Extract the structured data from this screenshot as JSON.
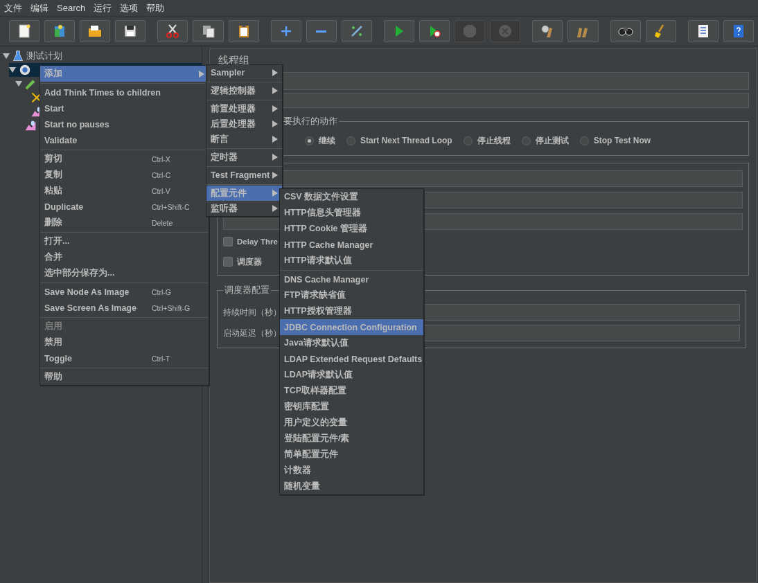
{
  "menubar": [
    {
      "label": "文件"
    },
    {
      "label": "编辑"
    },
    {
      "label": "Search"
    },
    {
      "label": "运行"
    },
    {
      "label": "选项"
    },
    {
      "label": "帮助"
    }
  ],
  "toolbar": [
    {
      "kind": "new",
      "disabled": false,
      "gap": false
    },
    {
      "kind": "templates",
      "disabled": false,
      "gap": false
    },
    {
      "kind": "open",
      "disabled": false,
      "gap": false
    },
    {
      "kind": "save",
      "disabled": false,
      "gap": false
    },
    {
      "kind": "cut",
      "disabled": false,
      "gap": true
    },
    {
      "kind": "copy",
      "disabled": false,
      "gap": false
    },
    {
      "kind": "paste",
      "disabled": false,
      "gap": false
    },
    {
      "kind": "expand",
      "disabled": false,
      "gap": true
    },
    {
      "kind": "collapse",
      "disabled": false,
      "gap": false
    },
    {
      "kind": "toggle",
      "disabled": false,
      "gap": false
    },
    {
      "kind": "start",
      "disabled": false,
      "gap": true
    },
    {
      "kind": "start-no-pause",
      "disabled": false,
      "gap": false
    },
    {
      "kind": "stop",
      "disabled": true,
      "gap": false
    },
    {
      "kind": "shutdown",
      "disabled": true,
      "gap": false
    },
    {
      "kind": "clear",
      "disabled": false,
      "gap": true
    },
    {
      "kind": "clear-all",
      "disabled": false,
      "gap": false
    },
    {
      "kind": "search",
      "disabled": false,
      "gap": true
    },
    {
      "kind": "reset",
      "disabled": false,
      "gap": false
    },
    {
      "kind": "functions",
      "disabled": false,
      "gap": true
    },
    {
      "kind": "help",
      "disabled": false,
      "gap": false
    }
  ],
  "tree": [
    {
      "kind": "plan",
      "label": "测试计划",
      "selected": false,
      "expanded": true,
      "children": [
        {
          "kind": "thread-group",
          "selected": true,
          "expanded": true,
          "children": [
            {
              "kind": "sampler",
              "selected": false,
              "expanded": true,
              "children": [
                {
                  "kind": "tool",
                  "selected": false
                },
                {
                  "kind": "listener",
                  "selected": false
                }
              ]
            },
            {
              "kind": "listener",
              "selected": false
            }
          ]
        }
      ]
    }
  ],
  "panel": {
    "title": "线程组",
    "action_group": {
      "legend": "要执行的动作",
      "options": [
        {
          "label": "继续",
          "selected": true
        },
        {
          "label": "Start Next Thread Loop",
          "selected": false
        },
        {
          "label": "停止线程",
          "selected": false
        },
        {
          "label": "停止测试",
          "selected": false
        },
        {
          "label": "Stop Test Now",
          "selected": false
        }
      ]
    },
    "checkboxes": [
      {
        "label": "Delay Thre",
        "checked": false
      },
      {
        "label": "调度器",
        "checked": false
      }
    ],
    "scheduler": {
      "legend": "调度器配置",
      "rows": [
        {
          "label": "持续时间（秒）"
        },
        {
          "label": "启动延迟（秒）"
        }
      ]
    }
  },
  "context_menu": [
    {
      "kind": "item",
      "label": "添加",
      "selected": true,
      "disabled": false,
      "submenu": true
    },
    {
      "kind": "separator"
    },
    {
      "kind": "item",
      "label": "Add Think Times to children",
      "selected": false,
      "disabled": false,
      "submenu": false
    },
    {
      "kind": "item",
      "label": "Start",
      "selected": false,
      "disabled": false,
      "submenu": false
    },
    {
      "kind": "item",
      "label": "Start no pauses",
      "selected": false,
      "disabled": false,
      "submenu": false
    },
    {
      "kind": "item",
      "label": "Validate",
      "selected": false,
      "disabled": false,
      "submenu": false
    },
    {
      "kind": "separator"
    },
    {
      "kind": "item",
      "label": "剪切",
      "shortcut": "Ctrl-X",
      "selected": false,
      "disabled": false,
      "submenu": false
    },
    {
      "kind": "item",
      "label": "复制",
      "shortcut": "Ctrl-C",
      "selected": false,
      "disabled": false,
      "submenu": false
    },
    {
      "kind": "item",
      "label": "粘贴",
      "shortcut": "Ctrl-V",
      "selected": false,
      "disabled": false,
      "submenu": false
    },
    {
      "kind": "item",
      "label": "Duplicate",
      "shortcut": "Ctrl+Shift-C",
      "selected": false,
      "disabled": false,
      "submenu": false
    },
    {
      "kind": "item",
      "label": "删除",
      "shortcut": "Delete",
      "selected": false,
      "disabled": false,
      "submenu": false
    },
    {
      "kind": "separator"
    },
    {
      "kind": "item",
      "label": "打开...",
      "selected": false,
      "disabled": false,
      "submenu": false
    },
    {
      "kind": "item",
      "label": "合并",
      "selected": false,
      "disabled": false,
      "submenu": false
    },
    {
      "kind": "item",
      "label": "选中部分保存为...",
      "selected": false,
      "disabled": false,
      "submenu": false
    },
    {
      "kind": "separator"
    },
    {
      "kind": "item",
      "label": "Save Node As Image",
      "shortcut": "Ctrl-G",
      "selected": false,
      "disabled": false,
      "submenu": false
    },
    {
      "kind": "item",
      "label": "Save Screen As Image",
      "shortcut": "Ctrl+Shift-G",
      "selected": false,
      "disabled": false,
      "submenu": false
    },
    {
      "kind": "separator"
    },
    {
      "kind": "item",
      "label": "启用",
      "selected": false,
      "disabled": true,
      "submenu": false
    },
    {
      "kind": "item",
      "label": "禁用",
      "selected": false,
      "disabled": false,
      "submenu": false
    },
    {
      "kind": "item",
      "label": "Toggle",
      "shortcut": "Ctrl-T",
      "selected": false,
      "disabled": false,
      "submenu": false
    },
    {
      "kind": "separator"
    },
    {
      "kind": "item",
      "label": "帮助",
      "selected": false,
      "disabled": false,
      "submenu": false
    }
  ],
  "add_submenu": [
    {
      "kind": "item",
      "label": "Sampler",
      "selected": false,
      "disabled": false,
      "submenu": true
    },
    {
      "kind": "separator"
    },
    {
      "kind": "item",
      "label": "逻辑控制器",
      "selected": false,
      "disabled": false,
      "submenu": true
    },
    {
      "kind": "separator"
    },
    {
      "kind": "item",
      "label": "前置处理器",
      "selected": false,
      "disabled": false,
      "submenu": true
    },
    {
      "kind": "item",
      "label": "后置处理器",
      "selected": false,
      "disabled": false,
      "submenu": true
    },
    {
      "kind": "item",
      "label": "断言",
      "selected": false,
      "disabled": false,
      "submenu": true
    },
    {
      "kind": "separator"
    },
    {
      "kind": "item",
      "label": "定时器",
      "selected": false,
      "disabled": false,
      "submenu": true
    },
    {
      "kind": "separator"
    },
    {
      "kind": "item",
      "label": "Test Fragment",
      "selected": false,
      "disabled": false,
      "submenu": true
    },
    {
      "kind": "separator"
    },
    {
      "kind": "item",
      "label": "配置元件",
      "selected": true,
      "disabled": false,
      "submenu": true
    },
    {
      "kind": "item",
      "label": "监听器",
      "selected": false,
      "disabled": false,
      "submenu": true
    }
  ],
  "config_submenu": [
    {
      "kind": "item",
      "label": "CSV 数据文件设置",
      "selected": false,
      "disabled": false,
      "submenu": false
    },
    {
      "kind": "item",
      "label": "HTTP信息头管理器",
      "selected": false,
      "disabled": false,
      "submenu": false
    },
    {
      "kind": "item",
      "label": "HTTP Cookie 管理器",
      "selected": false,
      "disabled": false,
      "submenu": false
    },
    {
      "kind": "item",
      "label": "HTTP Cache Manager",
      "selected": false,
      "disabled": false,
      "submenu": false
    },
    {
      "kind": "item",
      "label": "HTTP请求默认值",
      "selected": false,
      "disabled": false,
      "submenu": false
    },
    {
      "kind": "separator"
    },
    {
      "kind": "item",
      "label": "DNS Cache Manager",
      "selected": false,
      "disabled": false,
      "submenu": false
    },
    {
      "kind": "item",
      "label": "FTP请求缺省值",
      "selected": false,
      "disabled": false,
      "submenu": false
    },
    {
      "kind": "item",
      "label": "HTTP授权管理器",
      "selected": false,
      "disabled": false,
      "submenu": false
    },
    {
      "kind": "item",
      "label": "JDBC Connection Configuration",
      "selected": true,
      "disabled": false,
      "submenu": false
    },
    {
      "kind": "item",
      "label": "Java请求默认值",
      "selected": false,
      "disabled": false,
      "submenu": false
    },
    {
      "kind": "item",
      "label": "LDAP Extended Request Defaults",
      "selected": false,
      "disabled": false,
      "submenu": false
    },
    {
      "kind": "item",
      "label": "LDAP请求默认值",
      "selected": false,
      "disabled": false,
      "submenu": false
    },
    {
      "kind": "item",
      "label": "TCP取样器配置",
      "selected": false,
      "disabled": false,
      "submenu": false
    },
    {
      "kind": "item",
      "label": "密钥库配置",
      "selected": false,
      "disabled": false,
      "submenu": false
    },
    {
      "kind": "item",
      "label": "用户定义的变量",
      "selected": false,
      "disabled": false,
      "submenu": false
    },
    {
      "kind": "item",
      "label": "登陆配置元件/素",
      "selected": false,
      "disabled": false,
      "submenu": false
    },
    {
      "kind": "item",
      "label": "简单配置元件",
      "selected": false,
      "disabled": false,
      "submenu": false
    },
    {
      "kind": "item",
      "label": "计数器",
      "selected": false,
      "disabled": false,
      "submenu": false
    },
    {
      "kind": "item",
      "label": "随机变量",
      "selected": false,
      "disabled": false,
      "submenu": false
    }
  ]
}
